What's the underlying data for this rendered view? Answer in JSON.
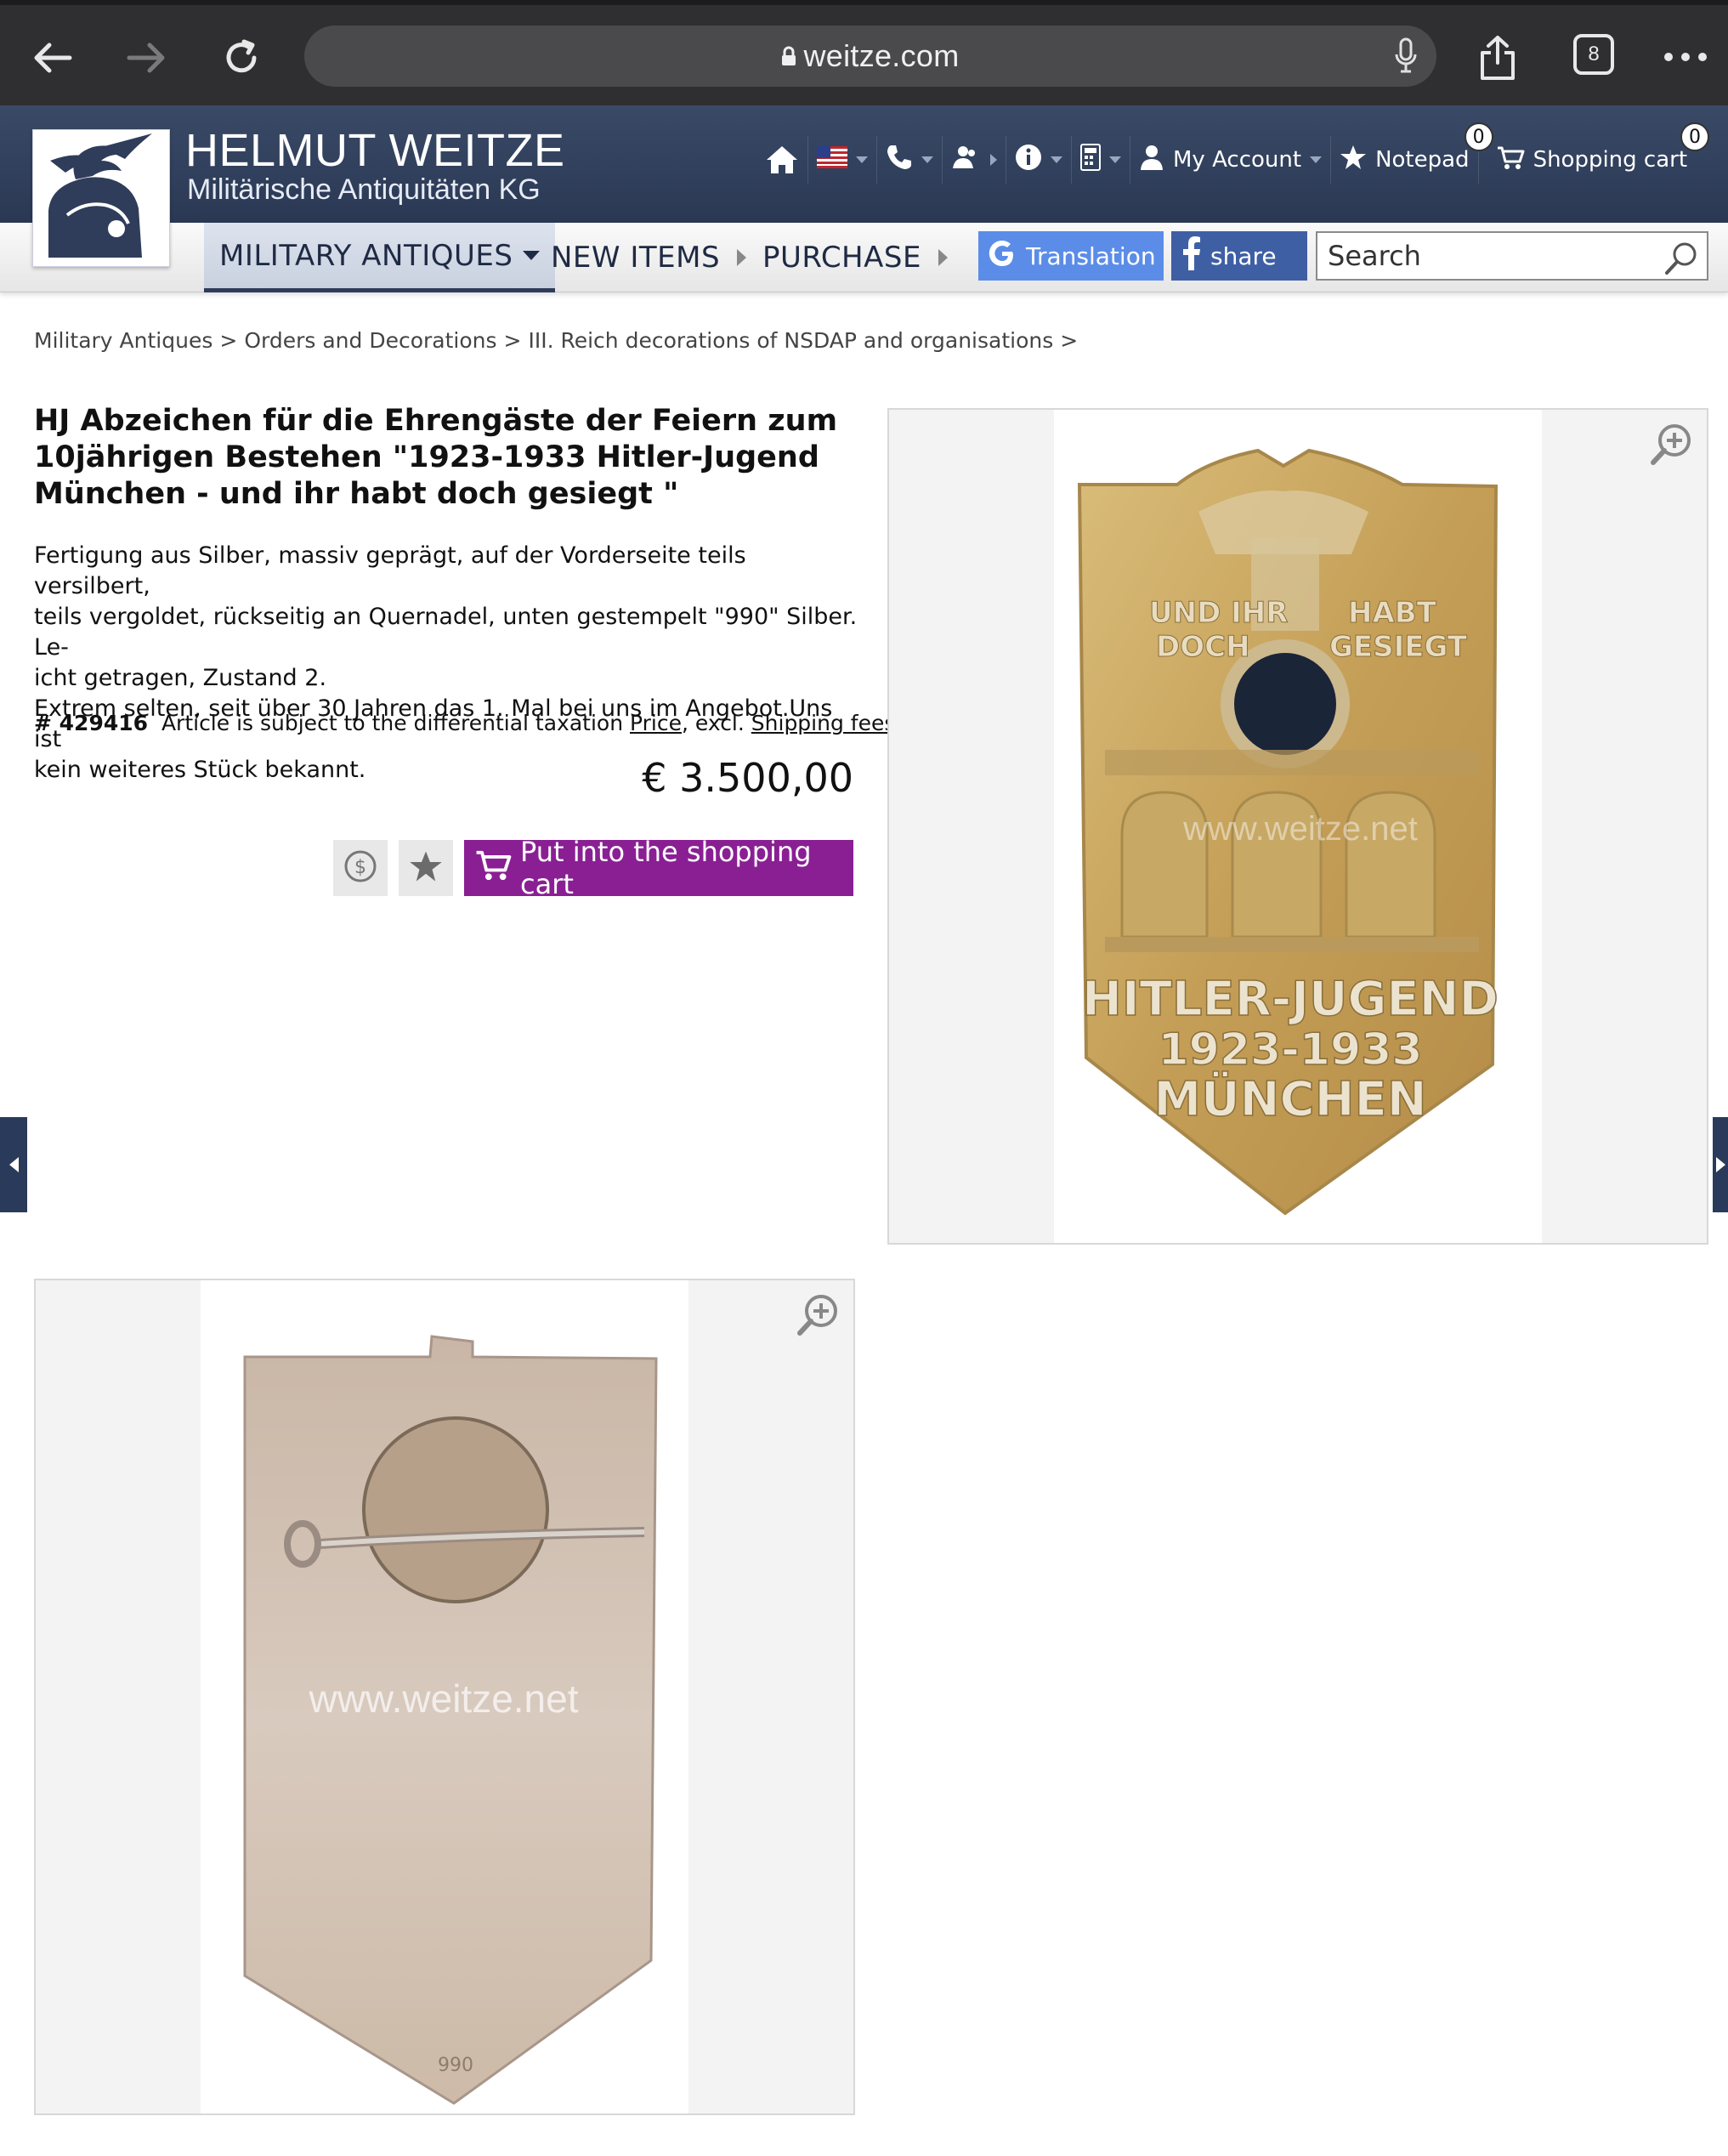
{
  "browser": {
    "url": "weitze.com",
    "tab_count": "8",
    "icons": [
      "back-arrow-icon",
      "forward-arrow-icon",
      "reload-icon",
      "lock-icon",
      "microphone-icon",
      "share-icon",
      "tabs-icon",
      "more-icon"
    ]
  },
  "header": {
    "brand_title": "HELMUT WEITZE",
    "brand_subtitle": "Militärische Antiquitäten KG",
    "my_account": "My Account",
    "notepad": "Notepad",
    "notepad_count": "0",
    "shopping_cart": "Shopping cart",
    "cart_count": "0"
  },
  "nav": {
    "military_antiques": "MILITARY ANTIQUES",
    "new_items": "NEW ITEMS",
    "purchase": "PURCHASE",
    "translation": "Translation",
    "share": "share",
    "search_placeholder": "Search"
  },
  "breadcrumb": {
    "items": [
      "Military Antiques",
      "Orders and Decorations",
      "III. Reich decorations of NSDAP and organisations"
    ],
    "separator": ">"
  },
  "product": {
    "title": "HJ Abzeichen für die Ehrengäste der Feiern zum 10jährigen Bestehen \"1923-1933 Hitler-Jugend München - und ihr habt doch gesiegt \"",
    "desc_line1": "Fertigung aus Silber, massiv geprägt, auf der Vorderseite teils versilbert,",
    "desc_line2": "teils vergoldet, rückseitig an Quernadel, unten gestempelt \"990\" Silber. Le-",
    "desc_line3": "icht getragen, Zustand 2.",
    "desc_line4": "Extrem selten, seit über 30 Jahren das 1. Mal bei uns im Angebot.Uns ist",
    "desc_line5": "kein weiteres Stück bekannt.",
    "article_no": "# 429416",
    "tax_note": "Article is subject to the differential taxation",
    "price_link": "Price",
    "excl": ", excl.",
    "shipping_link": "Shipping fees",
    "price": "€ 3.500,00",
    "cart_button": "Put into the shopping cart"
  },
  "images": {
    "front_badge": {
      "text_left_top": "UND IHR",
      "text_left_bottom": "DOCH",
      "text_right_top": "HABT",
      "text_right_bottom": "GESIEGT",
      "watermark": "www.weitze.net",
      "line1": "HITLER-JUGEND",
      "line2": "1923-1933",
      "line3": "MÜNCHEN"
    },
    "back_badge": {
      "watermark": "www.weitze.net",
      "stamp": "990"
    }
  },
  "colors": {
    "chrome_bg": "#2f2f31",
    "header_bg": "#2f3d5a",
    "cart_button": "#8a1f94",
    "translate_button": "#5b8de8",
    "share_button": "#3f5fa4",
    "badge_gold": "#c9a85a"
  }
}
